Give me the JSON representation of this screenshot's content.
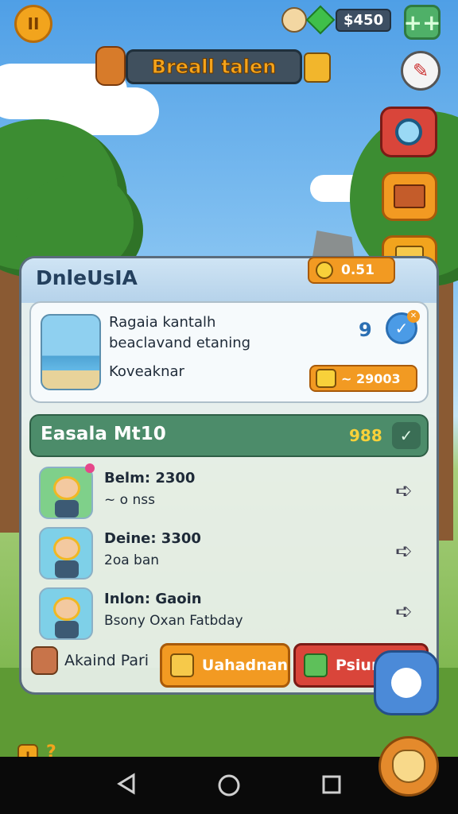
{
  "top_bar": {
    "pause_label": "II",
    "currency_value": "$450",
    "add_label": "++",
    "title": "Breall talen"
  },
  "side_buttons": [
    "edit-icon",
    "camera-icon",
    "book-icon",
    "bag-icon"
  ],
  "panel": {
    "title": "DnleUsIA",
    "timer_value": "0.51",
    "feature": {
      "line1": "Ragaia kantalh",
      "line2": "beaclavand etaning",
      "line3": "Koveaknar",
      "level": "9",
      "price": "~ 29003"
    },
    "section": {
      "title": "Easala Mt10",
      "count": "988"
    },
    "rows": [
      {
        "name": "Belm: 2300",
        "sub": "~ o nss",
        "avatar_bg": "#7fd08a"
      },
      {
        "name": "Deine: 3300",
        "sub": "2oa ban",
        "avatar_bg": "#7ed0e8"
      },
      {
        "name": "Inlon: Gaoin",
        "sub": "Bsony Oxan Fatbday",
        "avatar_bg": "#7ed0e8"
      }
    ],
    "footer": {
      "label": "Akaind Pari",
      "orange_button": "Uahadnan",
      "red_button": "Psiun"
    }
  },
  "bottom": {
    "warn_label": "!",
    "help_label": "?"
  },
  "colors": {
    "accent_orange": "#f29a22",
    "accent_red": "#d9453a",
    "section_green": "#4c8c6a"
  }
}
